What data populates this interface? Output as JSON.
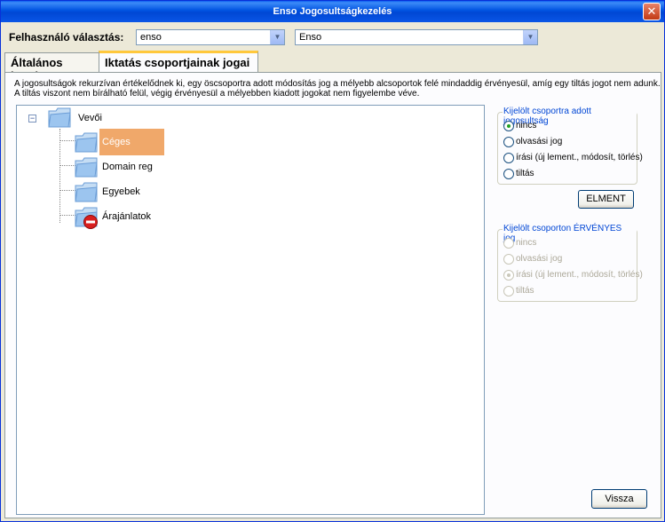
{
  "window": {
    "title": "Enso Jogosultságkezelés",
    "close_symbol": "✕"
  },
  "user": {
    "label": "Felhasználó választás:",
    "login_value": "enso",
    "name_value": "Enso"
  },
  "tabs": [
    {
      "label": "Általános jogok"
    },
    {
      "label": "Iktatás csoportjainak jogai"
    }
  ],
  "info": {
    "line1": "A jogosultságok rekurzívan értékelődnek ki, egy öscsoportra adott módosítás jog a mélyebb alcsoportok felé mindaddig érvényesül, amíg egy tiltás jogot nem adunk.",
    "line2": "A tiltás viszont nem bírálható felül, végig érvényesül a mélyebben kiadott jogokat nem figyelembe véve."
  },
  "tree": {
    "root": {
      "label": "Vevői",
      "expander": "−"
    },
    "children": [
      {
        "label": "Céges papírok",
        "selected": true,
        "icon": "folder-icon"
      },
      {
        "label": "Domain reg",
        "selected": false,
        "icon": "folder-icon"
      },
      {
        "label": "Egyebek",
        "selected": false,
        "icon": "folder-icon"
      },
      {
        "label": "Árajánlatok",
        "selected": false,
        "icon": "folder-forbidden-icon"
      }
    ]
  },
  "assigned_group": {
    "title": "Kijelölt csoportra adott jogosultság",
    "options": [
      "nincs",
      "olvasási jog",
      "írási (új lement., módosít, törlés)",
      "tiltás"
    ],
    "selected_index": 0
  },
  "save_button": "ELMENT",
  "effective_group": {
    "title": "Kijelölt csoporton ÉRVÉNYES jog",
    "options": [
      "nincs",
      "olvasási jog",
      "írási (új lement., módosít, törlés)",
      "tiltás"
    ],
    "selected_index": 2
  },
  "back_button": "Vissza",
  "colors": {
    "selection": "#f0a86a",
    "group_title": "#0046d5",
    "tab_highlight": "#ffc83c"
  }
}
